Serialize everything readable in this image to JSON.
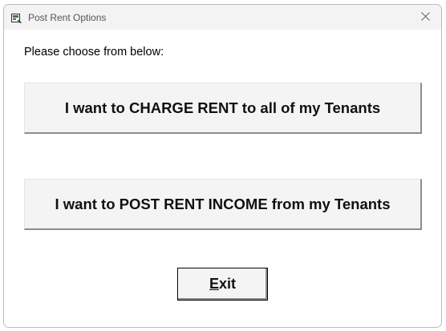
{
  "window": {
    "title": "Post Rent Options",
    "icon": "ledger-app-icon",
    "close_glyph": "✕"
  },
  "dialog": {
    "prompt": "Please choose from below:",
    "charge_rent_label": "I want to CHARGE RENT to all of my Tenants",
    "post_income_label": "I want to POST RENT INCOME from my Tenants",
    "exit": {
      "mnemonic": "E",
      "rest": "xit"
    }
  },
  "colors": {
    "titlebar_bg": "#f3f3f3",
    "button_face": "#f4f4f4",
    "button_shadow": "#8c8c8c"
  }
}
